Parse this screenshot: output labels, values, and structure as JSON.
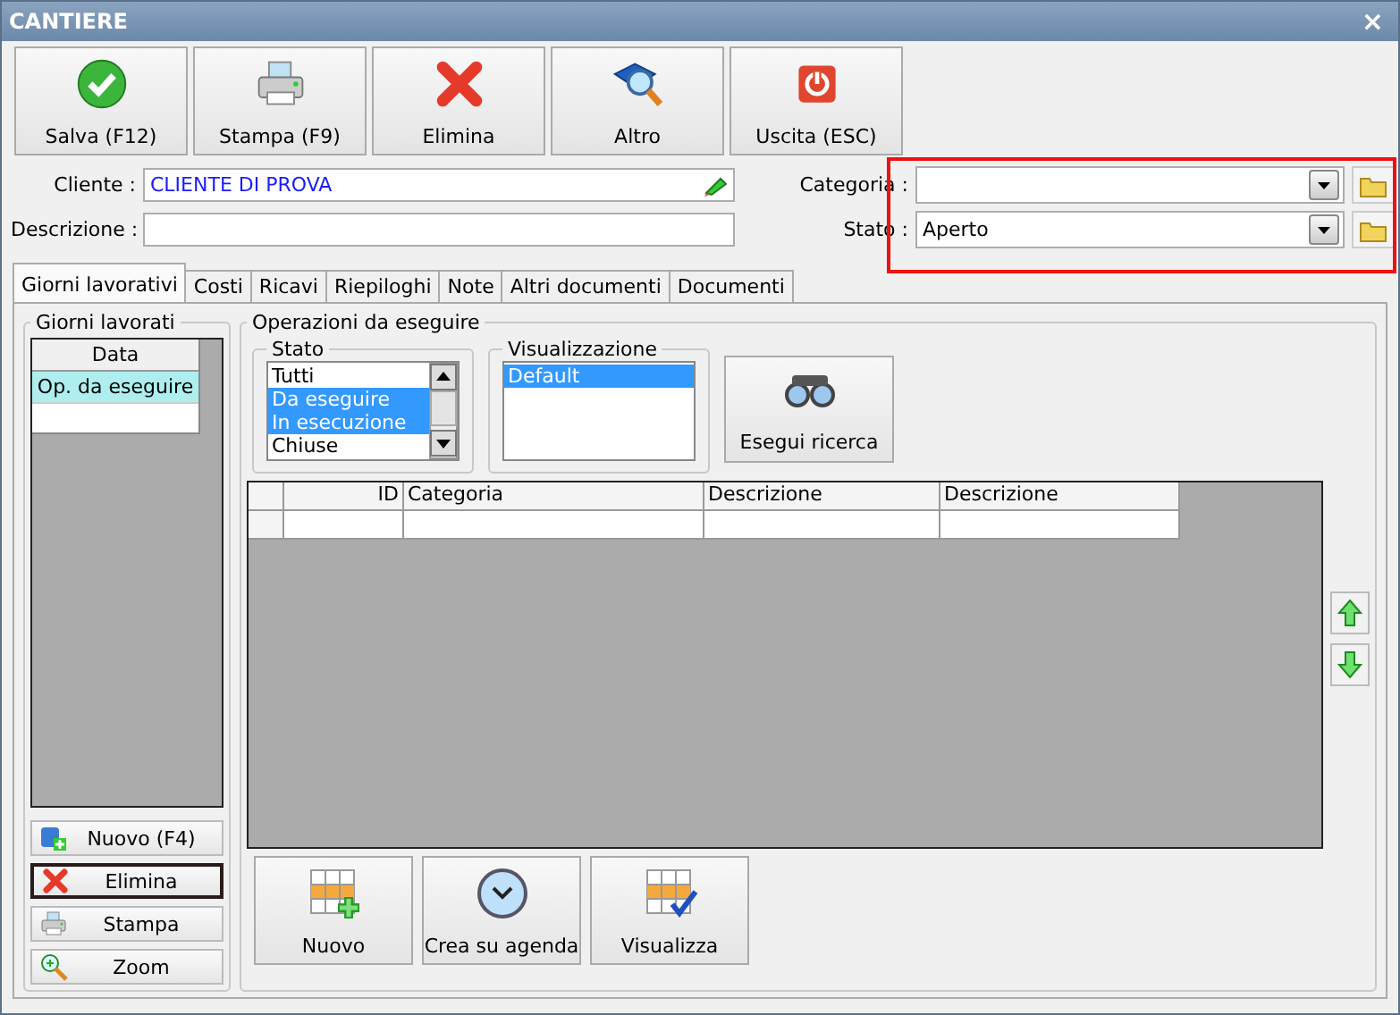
{
  "window": {
    "title": "CANTIERE",
    "close": "×"
  },
  "toolbar": [
    {
      "label": "Salva (F12)",
      "kind": "save"
    },
    {
      "label": "Stampa (F9)",
      "kind": "print"
    },
    {
      "label": "Elimina",
      "kind": "delete"
    },
    {
      "label": "Altro",
      "kind": "search"
    },
    {
      "label": "Uscita (ESC)",
      "kind": "exit"
    }
  ],
  "form": {
    "cliente": {
      "label": "Cliente :",
      "value": "CLIENTE DI PROVA"
    },
    "descrizione": {
      "label": "Descrizione :"
    },
    "categoria": {
      "label": "Categoria :"
    },
    "stato": {
      "label": "Stato :",
      "value": "Aperto"
    }
  },
  "highlight_box": true,
  "tabs": [
    {
      "label": "Giorni lavorativi",
      "selected": true
    },
    {
      "label": "Costi",
      "selected": false
    },
    {
      "label": "Ricavi",
      "selected": false
    },
    {
      "label": "Riepiloghi",
      "selected": false
    },
    {
      "label": "Note",
      "selected": false
    },
    {
      "label": "Altri documenti",
      "selected": false
    },
    {
      "label": "Documenti",
      "selected": false
    }
  ],
  "giorni_lavorati": {
    "title": "Giorni lavorati",
    "column": "Data",
    "rows": [
      {
        "label": "Op. da eseguire",
        "selected": true
      }
    ],
    "buttons": [
      {
        "label": "Nuovo (F4)",
        "kind": "new",
        "focused": false
      },
      {
        "label": "Elimina",
        "kind": "delete",
        "focused": true
      },
      {
        "label": "Stampa",
        "kind": "print",
        "focused": false
      },
      {
        "label": "Zoom",
        "kind": "zoom",
        "focused": false
      }
    ]
  },
  "operazioni": {
    "title": "Operazioni da eseguire",
    "stato": {
      "title": "Stato",
      "items": [
        {
          "label": "Tutti",
          "selected": false
        },
        {
          "label": "Da eseguire",
          "selected": true
        },
        {
          "label": "In esecuzione",
          "selected": true
        },
        {
          "label": "Chiuse",
          "selected": false
        }
      ]
    },
    "visualizzazione": {
      "title": "Visualizzazione",
      "items": [
        {
          "label": "Default",
          "selected": true
        }
      ]
    },
    "search_button": "Esegui ricerca",
    "table": {
      "columns": [
        "ID",
        "Categoria",
        "Descrizione",
        "Descrizione"
      ]
    },
    "buttons": [
      {
        "label": "Nuovo",
        "kind": "grid-add"
      },
      {
        "label": "Crea su agenda",
        "kind": "clock"
      },
      {
        "label": "Visualizza",
        "kind": "grid-check"
      }
    ]
  }
}
